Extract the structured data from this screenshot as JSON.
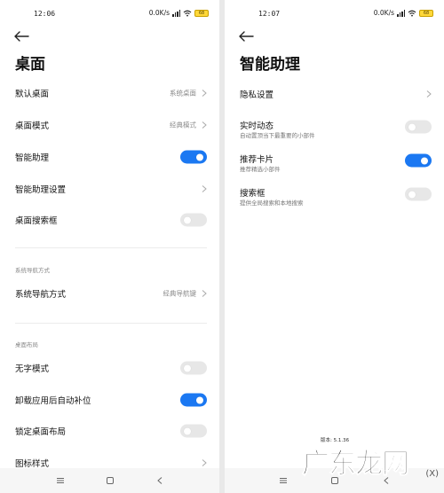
{
  "left": {
    "status": {
      "time": "12:06",
      "speed": "0.0K/s",
      "battery": "68"
    },
    "title": "桌面",
    "rows": [
      {
        "label": "默认桌面",
        "value": "系统桌面"
      },
      {
        "label": "桌面模式",
        "value": "经典模式"
      },
      {
        "label": "智能助理"
      },
      {
        "label": "智能助理设置"
      },
      {
        "label": "桌面搜索框"
      }
    ],
    "section_nav": "系统导航方式",
    "nav_row": {
      "label": "系统导航方式",
      "value": "经典导航键"
    },
    "section_layout": "桌面布局",
    "layout_rows": [
      {
        "label": "无字模式"
      },
      {
        "label": "卸载应用后自动补位"
      },
      {
        "label": "锁定桌面布局"
      },
      {
        "label": "图标样式"
      }
    ]
  },
  "right": {
    "status": {
      "time": "12:07",
      "speed": "0.0K/s",
      "battery": "68"
    },
    "title": "智能助理",
    "privacy": {
      "label": "隐私设置"
    },
    "items": [
      {
        "label": "实时动态",
        "sub": "自动置顶当下最重要的小部件"
      },
      {
        "label": "推荐卡片",
        "sub": "推荐精选小部件"
      },
      {
        "label": "搜索框",
        "sub": "提供全局搜索和本地搜索"
      }
    ],
    "version": "版本: 5.1.36"
  },
  "watermark": {
    "main": "广东龙网",
    "small": "(X)"
  },
  "toggles": {
    "smart_assistant": true,
    "desktop_search": false,
    "no_text_mode": false,
    "auto_fill": true,
    "lock_layout": false,
    "live_updates": false,
    "recommended_cards": true,
    "search_box": false
  },
  "icons": {
    "back": "arrow-left-icon",
    "chevron": "chevron-right-icon",
    "nav_menu": "menu-icon",
    "nav_home": "home-square-icon",
    "nav_back": "back-triangle-icon"
  },
  "colors": {
    "toggle_on": "#1b78f2",
    "toggle_off": "#e7e7e7"
  }
}
